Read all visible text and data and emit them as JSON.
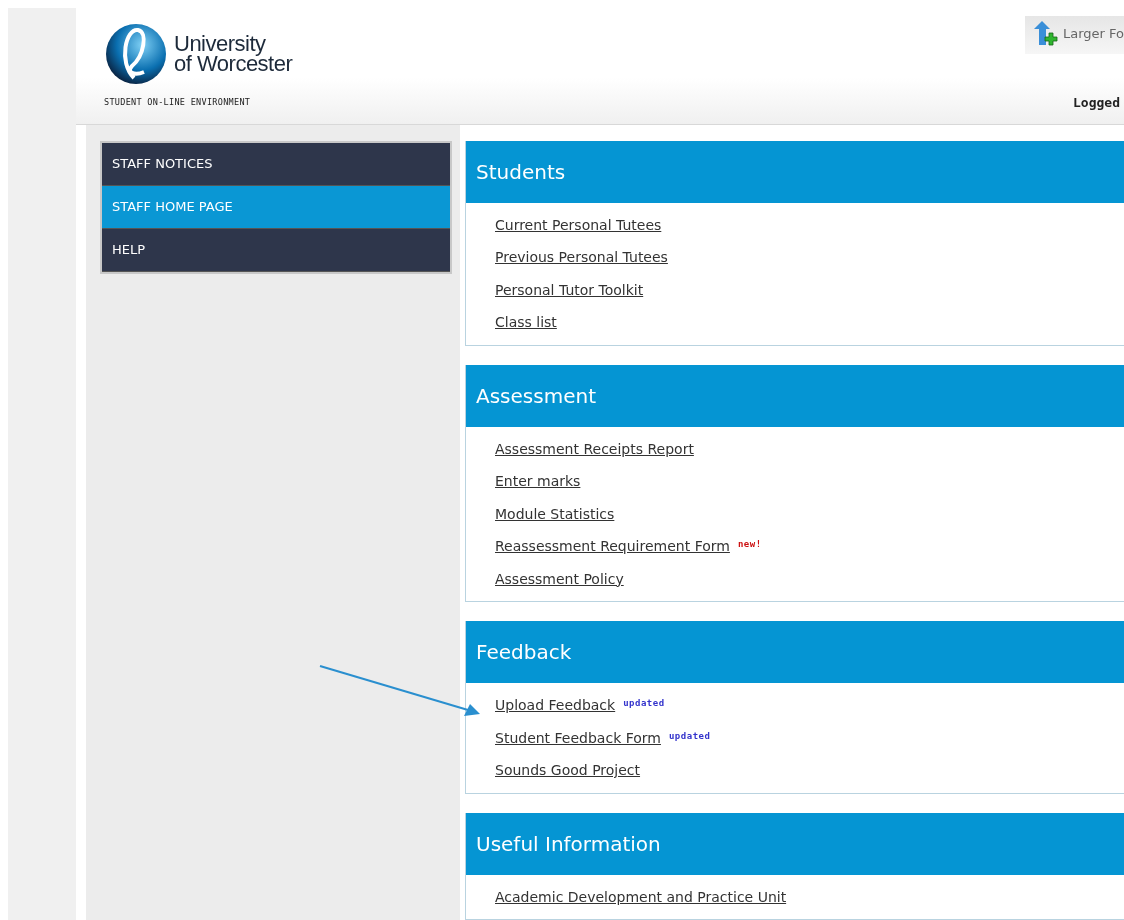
{
  "header": {
    "logo_text": [
      "University",
      "of Worcester"
    ],
    "tagline": "STUDENT ON-LINE ENVIRONMENT",
    "font_button": "Larger Fo",
    "login_text": "Logged"
  },
  "nav": [
    {
      "label": "STAFF NOTICES",
      "selected": false
    },
    {
      "label": "STAFF HOME PAGE",
      "selected": true
    },
    {
      "label": "HELP",
      "selected": false
    }
  ],
  "sections": [
    {
      "title": "Students",
      "links": [
        {
          "label": "Current Personal Tutees"
        },
        {
          "label": "Previous Personal Tutees"
        },
        {
          "label": "Personal Tutor Toolkit"
        },
        {
          "label": "Class list"
        }
      ]
    },
    {
      "title": "Assessment",
      "links": [
        {
          "label": "Assessment Receipts Report"
        },
        {
          "label": "Enter marks"
        },
        {
          "label": "Module Statistics"
        },
        {
          "label": "Reassessment Requirement Form",
          "badge": {
            "text": "new!",
            "kind": "new"
          }
        },
        {
          "label": "Assessment Policy"
        }
      ]
    },
    {
      "title": "Feedback",
      "links": [
        {
          "label": "Upload Feedback",
          "badge": {
            "text": "updated",
            "kind": "updated"
          }
        },
        {
          "label": "Student Feedback Form",
          "badge": {
            "text": "updated",
            "kind": "updated"
          }
        },
        {
          "label": "Sounds Good Project"
        }
      ]
    },
    {
      "title": "Useful Information",
      "links": [
        {
          "label": "Academic Development and Practice Unit"
        }
      ]
    }
  ]
}
